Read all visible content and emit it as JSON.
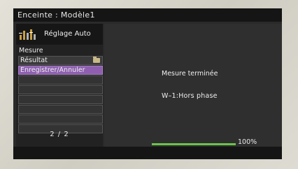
{
  "window": {
    "title": "Enceinte : Modèle1"
  },
  "header": {
    "title": "Réglage Auto",
    "icon": "speaker-level-icon"
  },
  "menu": {
    "section_label": "Mesure",
    "items": [
      {
        "label": "Résultat",
        "icon": "folder-icon"
      },
      {
        "label": "Enregistrer/Annuler",
        "selected": true
      },
      {
        "label": ""
      },
      {
        "label": ""
      },
      {
        "label": ""
      },
      {
        "label": ""
      },
      {
        "label": ""
      },
      {
        "label": ""
      }
    ],
    "page": "2 / 2"
  },
  "content": {
    "status": "Mesure terminée",
    "result": "W–1:Hors phase"
  },
  "progress": {
    "value": 1.0,
    "label": "100%"
  },
  "colors": {
    "selected": "#8d5fae",
    "progress": "#6bc34a"
  }
}
